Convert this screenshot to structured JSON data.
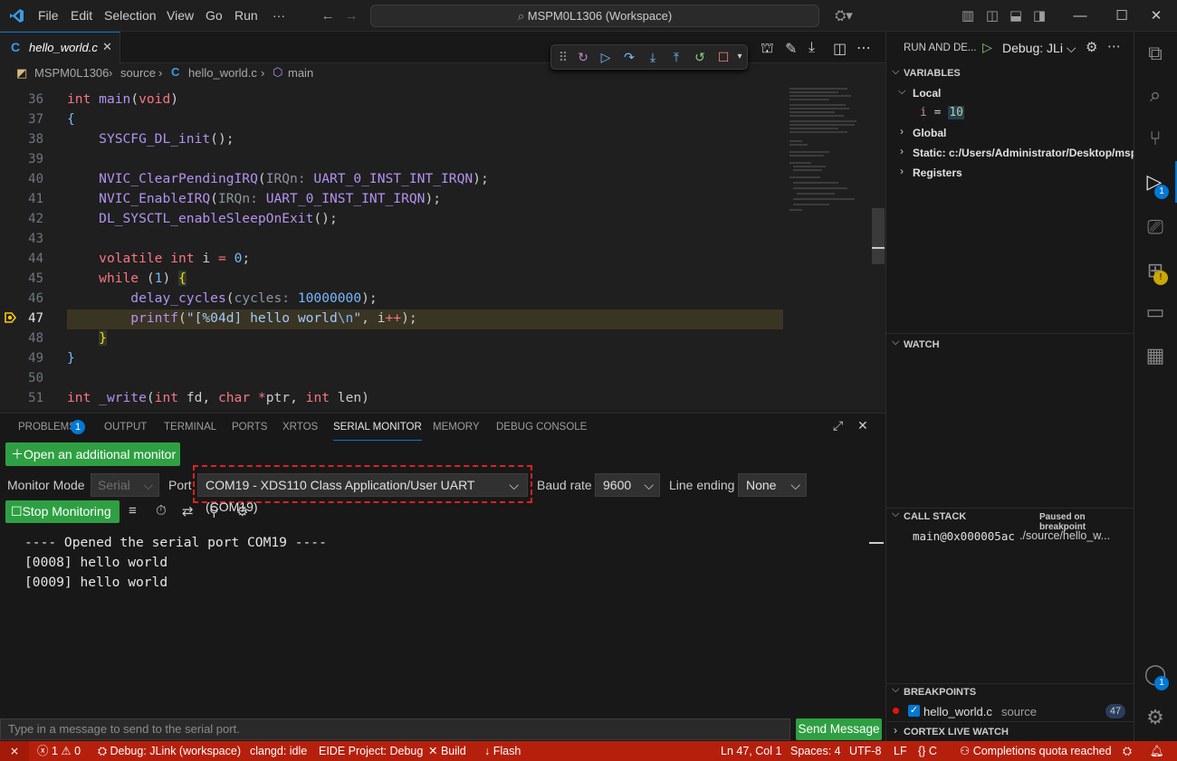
{
  "titlebar": {
    "menus": [
      "File",
      "Edit",
      "Selection",
      "View",
      "Go",
      "Run",
      "···"
    ],
    "search": "MSPM0L1306 (Workspace)"
  },
  "editor": {
    "tab": "hello_world.c",
    "breadcrumb": [
      "MSPM0L1306",
      "source",
      "hello_world.c",
      "main"
    ],
    "lines": [
      "36",
      "37",
      "38",
      "39",
      "40",
      "41",
      "42",
      "43",
      "44",
      "45",
      "46",
      "47",
      "48",
      "49",
      "50",
      "51"
    ]
  },
  "panel": {
    "tabs": [
      "PROBLEMS",
      "OUTPUT",
      "TERMINAL",
      "PORTS",
      "XRTOS",
      "SERIAL MONITOR",
      "MEMORY",
      "DEBUG CONSOLE"
    ],
    "problems_count": "1",
    "open_monitor": "Open an additional monitor",
    "monitor_mode_label": "Monitor Mode",
    "monitor_mode": "Serial",
    "port_label": "Port",
    "port": "COM19 - XDS110 Class Application/User UART (COM19)",
    "baud_label": "Baud rate",
    "baud": "9600",
    "line_ending_label": "Line ending",
    "line_ending": "None",
    "stop": "Stop Monitoring",
    "output": [
      "---- Opened the serial port COM19 ----",
      "[0008] hello world",
      "[0009] hello world"
    ],
    "message_placeholder": "Type in a message to send to the serial port.",
    "send": "Send Message"
  },
  "sidebar": {
    "run_title": "RUN AND DE...",
    "config": "Debug: JLi",
    "variables": "VARIABLES",
    "local": "Local",
    "var_name": "i",
    "var_eq": "=",
    "var_val": "10",
    "global": "Global",
    "static": "Static: c:/Users/Administrator/Desktop/msp-tes",
    "registers": "Registers",
    "watch": "WATCH",
    "callstack": "CALL STACK",
    "paused": "Paused on breakpoint",
    "frame": "main@0x000005ac",
    "frame_file": "./source/hello_w...",
    "breakpoints": "BREAKPOINTS",
    "bp_file": "hello_world.c",
    "bp_dir": "source",
    "bp_line": "47",
    "cortex": "CORTEX LIVE WATCH"
  },
  "activity": {
    "debug_badge": "1",
    "account_badge": "1"
  },
  "status": {
    "errors": "1",
    "warnings": "0",
    "debug": "Debug: JLink (workspace)",
    "clangd": "clangd: idle",
    "eide": "EIDE Project: Debug",
    "build": "Build",
    "flash": "Flash",
    "position": "Ln 47, Col 1",
    "spaces": "Spaces: 4",
    "encoding": "UTF-8",
    "eol": "LF",
    "lang": "C",
    "copilot": "Completions quota reached"
  }
}
